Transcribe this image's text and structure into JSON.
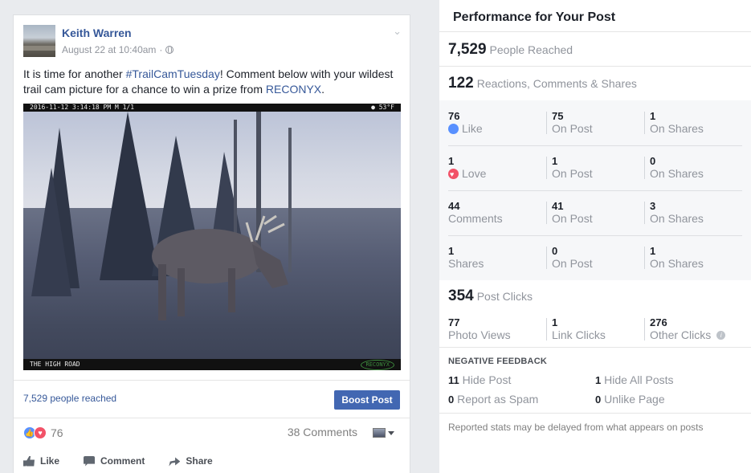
{
  "post": {
    "author": "Keith Warren",
    "date": "August 22 at 10:40am",
    "dot": "·",
    "text_parts": {
      "a": "It is time for another ",
      "hashtag": "#TrailCamTuesday",
      "b": "! Comment below with your wildest trail cam picture for a chance to win a prize from ",
      "mention": "RECONYX",
      "c": "."
    },
    "photo": {
      "overlay_top_left": "2016-11-12  3:14:18 PM  M 1/1",
      "overlay_top_right": "● 53°F",
      "overlay_bottom_left": "THE HIGH ROAD",
      "overlay_bottom_right": "RECONYX"
    },
    "reach": "7,529 people reached",
    "boost_label": "Boost Post",
    "reaction_count": "76",
    "comments": "38 Comments",
    "actions": {
      "like": "Like",
      "comment": "Comment",
      "share": "Share"
    }
  },
  "perf": {
    "title": "Performance for Your Post",
    "reached": {
      "value": "7,529",
      "label": "People Reached"
    },
    "engagement": {
      "value": "122",
      "label": "Reactions, Comments & Shares"
    },
    "rows": [
      {
        "total": "76",
        "label": "Like",
        "on_post": "75",
        "on_post_label": "On Post",
        "on_shares": "1",
        "on_shares_label": "On Shares"
      },
      {
        "total": "1",
        "label": "Love",
        "on_post": "1",
        "on_post_label": "On Post",
        "on_shares": "0",
        "on_shares_label": "On Shares"
      },
      {
        "total": "44",
        "label": "Comments",
        "on_post": "41",
        "on_post_label": "On Post",
        "on_shares": "3",
        "on_shares_label": "On Shares"
      },
      {
        "total": "1",
        "label": "Shares",
        "on_post": "0",
        "on_post_label": "On Post",
        "on_shares": "1",
        "on_shares_label": "On Shares"
      }
    ],
    "post_clicks": {
      "value": "354",
      "label": "Post Clicks"
    },
    "clicks": {
      "photo_views": "77",
      "photo_views_label": "Photo Views",
      "link_clicks": "1",
      "link_clicks_label": "Link Clicks",
      "other_clicks": "276",
      "other_clicks_label": "Other Clicks"
    },
    "negative": {
      "title": "NEGATIVE FEEDBACK",
      "hide_post": "11",
      "hide_post_label": "Hide Post",
      "hide_all": "1",
      "hide_all_label": "Hide All Posts",
      "spam": "0",
      "spam_label": "Report as Spam",
      "unlike": "0",
      "unlike_label": "Unlike Page"
    },
    "note": "Reported stats may be delayed from what appears on posts"
  },
  "colors": {
    "link": "#365899",
    "boost": "#4267b2",
    "like": "#5890ff",
    "love": "#f25268"
  },
  "icons": [
    "globe-icon",
    "chevron-down-icon",
    "like-icon",
    "love-icon",
    "comment-icon",
    "share-icon",
    "info-icon"
  ]
}
